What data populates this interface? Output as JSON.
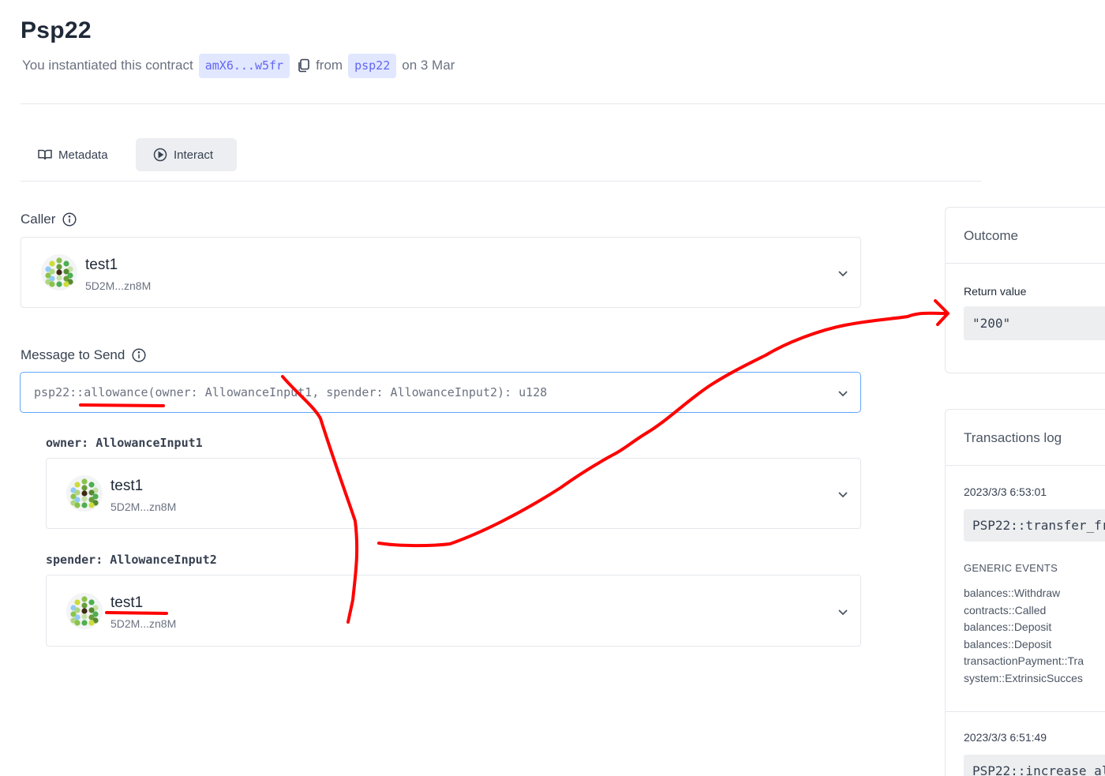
{
  "header": {
    "title": "Psp22",
    "instantiated_text": "You instantiated this contract",
    "contract_address": "amX6...w5fr",
    "from_text": "from",
    "code_name": "psp22",
    "date_text": "on 3 Mar"
  },
  "tabs": [
    {
      "label": "Metadata",
      "icon": "book-icon",
      "active": false
    },
    {
      "label": "Interact",
      "icon": "play-circle-icon",
      "active": true
    }
  ],
  "caller": {
    "label": "Caller",
    "account": {
      "name": "test1",
      "address": "5D2M...zn8M"
    }
  },
  "message": {
    "label": "Message to Send",
    "selected": "psp22::allowance(owner: AllowanceInput1, spender: AllowanceInput2): u128"
  },
  "params": [
    {
      "label_key": "owner:",
      "label_type": "AllowanceInput1",
      "account": {
        "name": "test1",
        "address": "5D2M...zn8M"
      }
    },
    {
      "label_key": "spender:",
      "label_type": "AllowanceInput2",
      "account": {
        "name": "test1",
        "address": "5D2M...zn8M"
      }
    }
  ],
  "outcome": {
    "title": "Outcome",
    "return_label": "Return value",
    "return_value": "\"200\""
  },
  "transactions_log": {
    "title": "Transactions log",
    "entries": [
      {
        "timestamp": "2023/3/3 6:53:01",
        "call": "PSP22::transfer_fr",
        "events_header": "GENERIC EVENTS",
        "events": [
          "balances::Withdraw",
          "contracts::Called",
          "balances::Deposit",
          "balances::Deposit",
          "transactionPayment::Tra",
          "system::ExtrinsicSucces"
        ]
      },
      {
        "timestamp": "2023/3/3 6:51:49",
        "call": "PSP22::increase_al"
      }
    ]
  },
  "colors": {
    "pill_bg": "#e0e7ff",
    "pill_text": "#6366f1",
    "focus_border": "#60a5fa",
    "annotation": "#ff0000"
  }
}
